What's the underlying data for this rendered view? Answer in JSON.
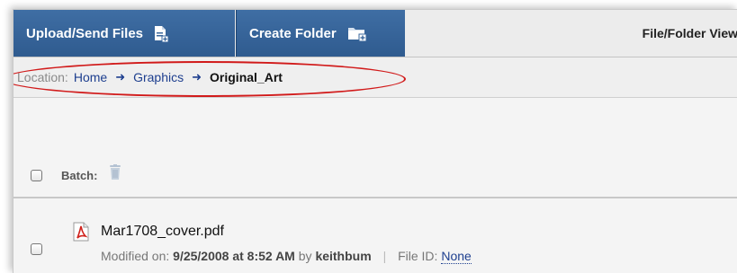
{
  "toolbar": {
    "upload_label": "Upload/Send Files",
    "create_folder_label": "Create Folder",
    "view_label": "File/Folder View"
  },
  "breadcrumb": {
    "label": "Location:",
    "items": [
      "Home",
      "Graphics",
      "Original_Art"
    ]
  },
  "batch": {
    "label": "Batch:"
  },
  "file": {
    "name": "Mar1708_cover.pdf",
    "modified_prefix": "Modified on:",
    "modified_date": "9/25/2008 at 8:52 AM",
    "by_text": "by",
    "author": "keithbum",
    "file_id_label": "File ID:",
    "file_id_value": "None"
  },
  "colors": {
    "toolbar_button": "#3a679c",
    "link": "#1e3f8f",
    "highlight": "#d11a1a",
    "pdf": "#d0221c"
  },
  "icons": {
    "upload": "document-upload-icon",
    "create_folder": "folder-add-icon",
    "breadcrumb_separator": "right-arrow-icon",
    "batch_delete": "trash-icon",
    "file_type": "pdf-icon"
  }
}
